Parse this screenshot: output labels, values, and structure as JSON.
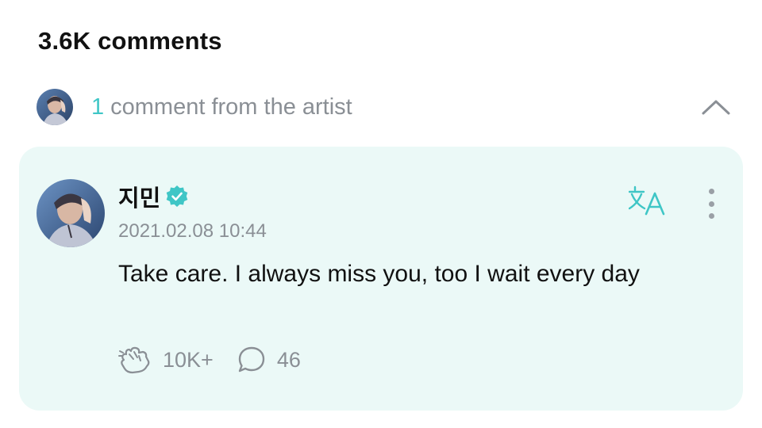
{
  "header": {
    "comments_count": "3.6K comments"
  },
  "artist_comments": {
    "count": "1",
    "label": "comment from the artist",
    "collapse_icon": "chevron-up-icon"
  },
  "comment": {
    "author": "지민",
    "verified_icon": "verified-badge-icon",
    "timestamp": "2021.02.08 10:44",
    "body": "Take care. I always miss you, too I wait every day",
    "translate_icon": "translate-icon",
    "more_icon": "more-vertical-icon",
    "likes": "10K+",
    "replies": "46",
    "like_icon": "cheer-hand-icon",
    "reply_icon": "speech-bubble-icon"
  },
  "colors": {
    "accent": "#3fc6c6",
    "card_background": "#ebf9f7",
    "muted_text": "#8a8f95"
  }
}
